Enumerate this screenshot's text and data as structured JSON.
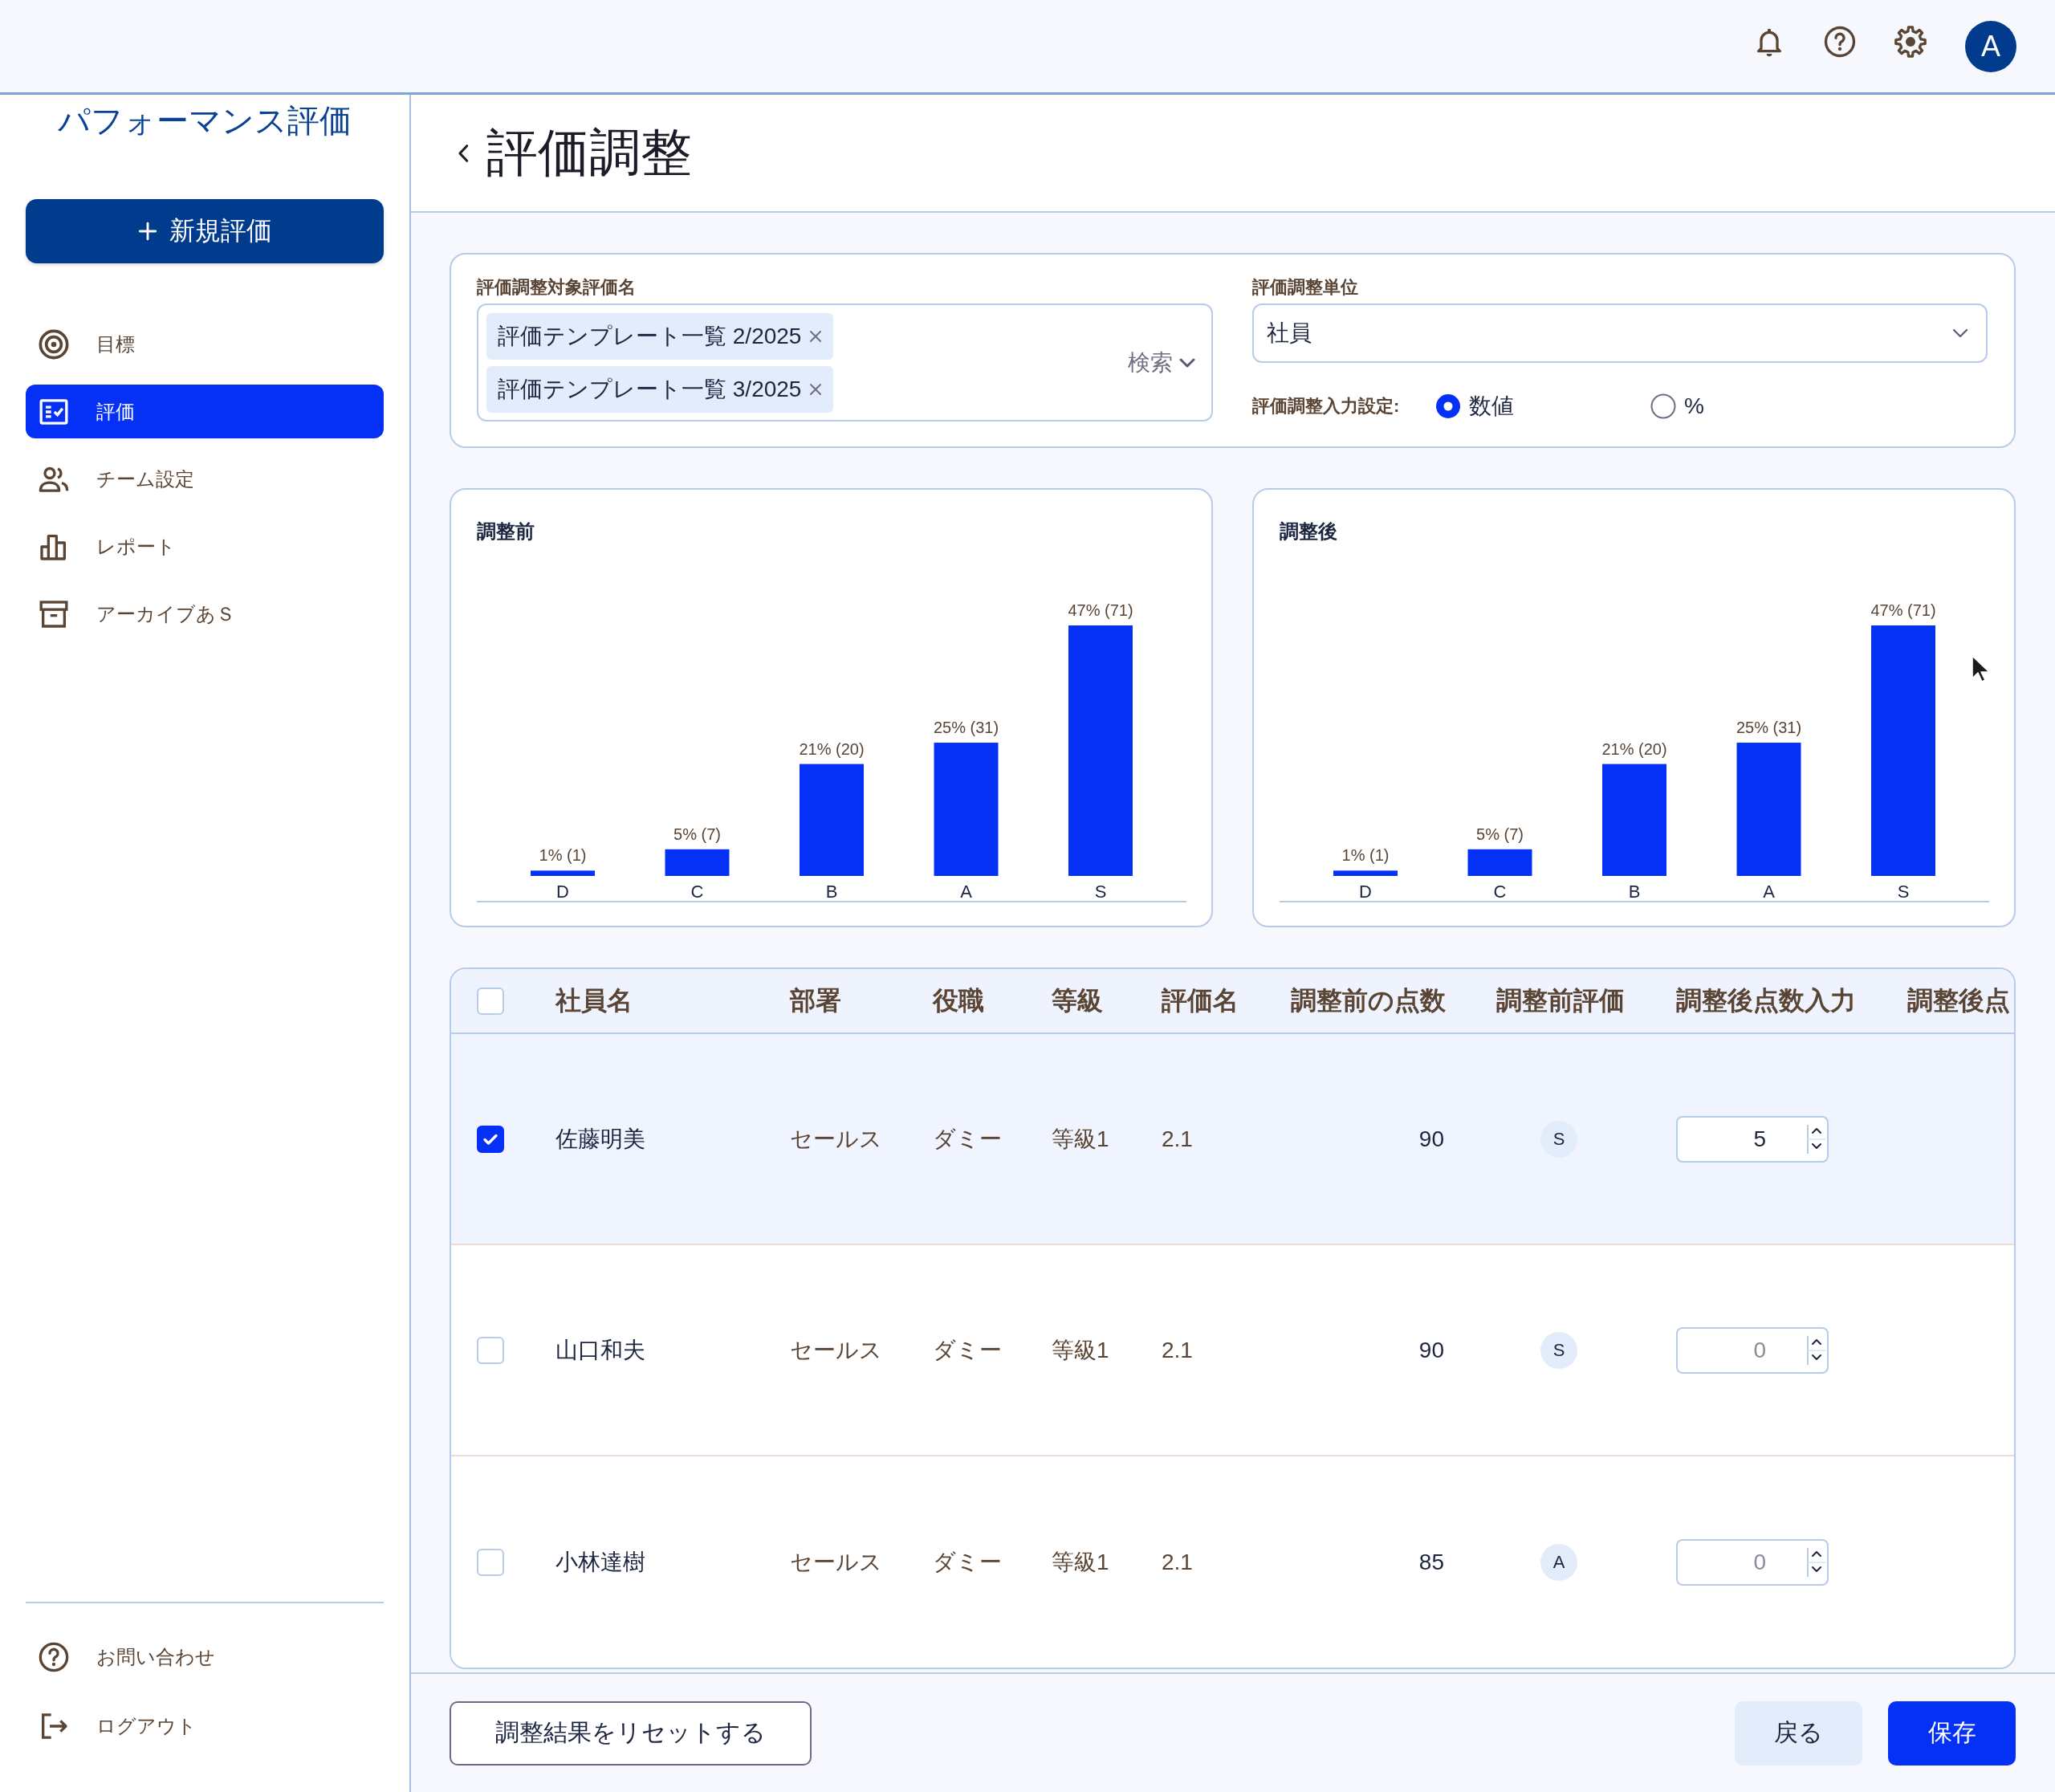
{
  "top_bar": {
    "avatar_initial": "A"
  },
  "sidebar": {
    "title": "パフォーマンス評価",
    "new_button": "新規評価",
    "items": [
      {
        "label": "目標",
        "selected": false
      },
      {
        "label": "評価",
        "selected": true
      },
      {
        "label": "チーム設定",
        "selected": false
      },
      {
        "label": "レポート",
        "selected": false
      },
      {
        "label": "アーカイブあＳ",
        "selected": false
      }
    ],
    "bottom_items": [
      {
        "label": "お問い合わせ"
      },
      {
        "label": "ログアウト"
      }
    ]
  },
  "page": {
    "title": "評価調整"
  },
  "filters": {
    "target_label": "評価調整対象評価名",
    "target_chips": [
      "評価テンプレート一覧 2/2025",
      "評価テンプレート一覧 3/2025"
    ],
    "search_label": "検索",
    "unit_label": "評価調整単位",
    "unit_value": "社員",
    "input_setting_label": "評価調整入力設定:",
    "input_options": [
      {
        "label": "数値",
        "selected": true
      },
      {
        "label": "%",
        "selected": false
      }
    ]
  },
  "charts": [
    {
      "chart_data": {
        "type": "bar",
        "title": "調整前",
        "categories": [
          "D",
          "C",
          "B",
          "A",
          "S"
        ],
        "values": [
          1,
          5,
          21,
          25,
          47
        ],
        "value_labels": [
          "1% (1)",
          "5% (7)",
          "21% (20)",
          "25% (31)",
          "47% (71)"
        ]
      }
    },
    {
      "chart_data": {
        "type": "bar",
        "title": "調整後",
        "categories": [
          "D",
          "C",
          "B",
          "A",
          "S"
        ],
        "values": [
          1,
          5,
          21,
          25,
          47
        ],
        "value_labels": [
          "1% (1)",
          "5% (7)",
          "21% (20)",
          "25% (31)",
          "47% (71)"
        ]
      }
    }
  ],
  "table": {
    "select_all": {
      "checked": false
    },
    "columns": [
      "社員名",
      "部署",
      "役職",
      "等級",
      "評価名",
      "調整前の点数",
      "調整前評価",
      "調整後点数入力",
      "調整後点"
    ],
    "rows": [
      {
        "selected": true,
        "checked": true,
        "name": "佐藤明美",
        "department": "セールス",
        "position": "ダミー",
        "grade": "等級1",
        "evaluation": "2.1",
        "score": "90",
        "rating": "S",
        "adjusted_input": {
          "value": "5"
        }
      },
      {
        "selected": false,
        "checked": false,
        "name": "山口和夫",
        "department": "セールス",
        "position": "ダミー",
        "grade": "等級1",
        "evaluation": "2.1",
        "score": "90",
        "rating": "S",
        "adjusted_input": {
          "placeholder": "0"
        }
      },
      {
        "selected": false,
        "checked": false,
        "name": "小林達樹",
        "department": "セールス",
        "position": "ダミー",
        "grade": "等級1",
        "evaluation": "2.1",
        "score": "85",
        "rating": "A",
        "adjusted_input": {
          "placeholder": "0"
        }
      }
    ]
  },
  "footer": {
    "reset_button": "調整結果をリセットする",
    "back_button": "戻る",
    "save_button": "保存"
  }
}
